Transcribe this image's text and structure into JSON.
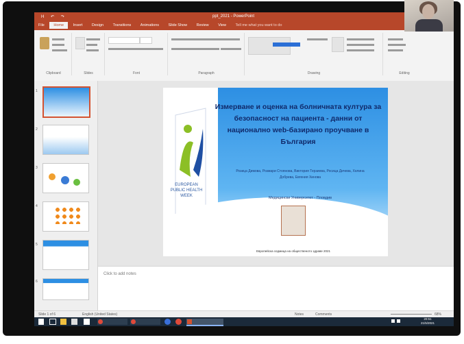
{
  "window": {
    "title": "ppt_2021 - PowerPoint",
    "quick_access": "H ↶ ↷"
  },
  "ribbon": {
    "tabs": [
      "File",
      "Home",
      "Insert",
      "Design",
      "Transitions",
      "Animations",
      "Slide Show",
      "Review",
      "View"
    ],
    "active_tab": "Home",
    "tell_me": "Tell me what you want to do",
    "groups": [
      "Clipboard",
      "Slides",
      "Font",
      "Paragraph",
      "Drawing",
      "Editing"
    ]
  },
  "slide": {
    "title": "Измерване и оценка на болничната култура за безопасност на пациента - данни от национално web-базирано проучване в България",
    "authors": "Розица Димова, Розмари Стоянова, Виктория Терзиева, Росица Дичева, Хелина Добрева, Евгения Хинова",
    "university": "Медицински Университет - Пловдив",
    "conference_logo_text": "EUROPEAN PUBLIC HEALTH WEEK",
    "footer": "Европейска седмица на общественото здраве 2021"
  },
  "notes": {
    "placeholder": "Click to add notes"
  },
  "status": {
    "slide_counter": "Slide 1 of 6",
    "language": "English (United States)",
    "notes_btn": "Notes",
    "comments_btn": "Comments",
    "zoom": "68%"
  },
  "taskbar": {
    "items": [
      "Windows",
      "Task View",
      "Explorer",
      "Store",
      "Chrome",
      "PowerPoint",
      "Skype"
    ],
    "time": "20:51",
    "date": "21/5/2021"
  },
  "colors": {
    "accent": "#b7472a",
    "slide_blue": "#2d8fe3",
    "title_navy": "#102a6b"
  }
}
